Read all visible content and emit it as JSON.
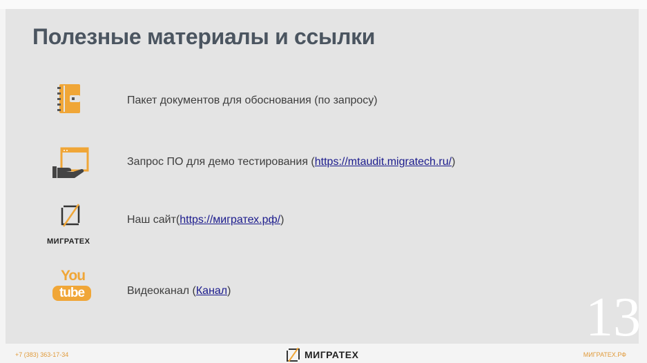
{
  "slide": {
    "title": "Полезные материалы и ссылки",
    "page_number": "13"
  },
  "items": [
    {
      "icon": "document-folder-icon",
      "text": "Пакет документов для обоснования (по запросу)"
    },
    {
      "icon": "hand-monitor-icon",
      "text_before": "Запрос ПО для демо тестирования (",
      "link": "https://mtaudit.migratech.ru/",
      "text_after": ")"
    },
    {
      "icon": "migratech-logo-icon",
      "logo_text": "МИГРАТЕХ",
      "text_before": "Наш сайт(",
      "link": "https://мигратех.рф/",
      "text_after": ")"
    },
    {
      "icon": "youtube-icon",
      "logo_you": "You",
      "logo_tube": "tube",
      "text_before": "Видеоканал (",
      "link": "Канал",
      "text_after": ")"
    }
  ],
  "footer": {
    "phone": "+7 (383) 363-17-34",
    "logo_text": "МИГРАТЕХ",
    "site": "МИГРАТЕХ.РФ"
  },
  "colors": {
    "accent": "#f0a637",
    "title": "#4b5560",
    "link": "#1a1a8c",
    "slide_bg": "#e4e4e4"
  }
}
